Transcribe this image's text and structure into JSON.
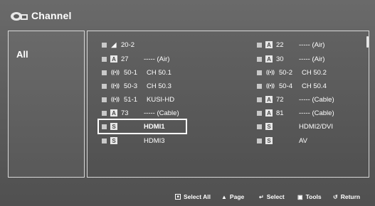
{
  "header": {
    "title": "Channel",
    "logo_icon": "antenna-tv-icon"
  },
  "sidebar": {
    "category": "All"
  },
  "channels_left": [
    {
      "icon": "antenna-icon",
      "icon_glyph": "◄",
      "num": "20-2",
      "name": ""
    },
    {
      "icon": "analog-a-icon",
      "icon_glyph": "A",
      "num": "27",
      "name": "----- (Air)"
    },
    {
      "icon": "digital-air-icon",
      "icon_glyph": "((•))",
      "num": "50-1",
      "name": "CH 50.1"
    },
    {
      "icon": "digital-air-icon",
      "icon_glyph": "((•))",
      "num": "50-3",
      "name": "CH 50.3"
    },
    {
      "icon": "digital-air-icon",
      "icon_glyph": "((•))",
      "num": "51-1",
      "name": "KUSI-HD"
    },
    {
      "icon": "analog-a-icon",
      "icon_glyph": "A",
      "num": "73",
      "name": "----- (Cable)"
    },
    {
      "icon": "source-s-icon",
      "icon_glyph": "S",
      "num": "",
      "name": "HDMI1",
      "selected": true
    },
    {
      "icon": "source-s-icon",
      "icon_glyph": "S",
      "num": "",
      "name": "HDMI3"
    }
  ],
  "channels_right": [
    {
      "icon": "analog-a-icon",
      "icon_glyph": "A",
      "num": "22",
      "name": "----- (Air)"
    },
    {
      "icon": "analog-a-icon",
      "icon_glyph": "A",
      "num": "30",
      "name": "----- (Air)"
    },
    {
      "icon": "digital-air-icon",
      "icon_glyph": "((•))",
      "num": "50-2",
      "name": "CH 50.2"
    },
    {
      "icon": "digital-air-icon",
      "icon_glyph": "((•))",
      "num": "50-4",
      "name": "CH 50.4"
    },
    {
      "icon": "analog-a-icon",
      "icon_glyph": "A",
      "num": "72",
      "name": "----- (Cable)"
    },
    {
      "icon": "analog-a-icon",
      "icon_glyph": "A",
      "num": "81",
      "name": "----- (Cable)"
    },
    {
      "icon": "source-s-icon",
      "icon_glyph": "S",
      "num": "",
      "name": "HDMI2/DVI"
    },
    {
      "icon": "source-s-icon",
      "icon_glyph": "S",
      "num": "",
      "name": "AV"
    }
  ],
  "footer": {
    "select_all": "Select All",
    "page": "Page",
    "select": "Select",
    "tools": "Tools",
    "return": "Return"
  }
}
